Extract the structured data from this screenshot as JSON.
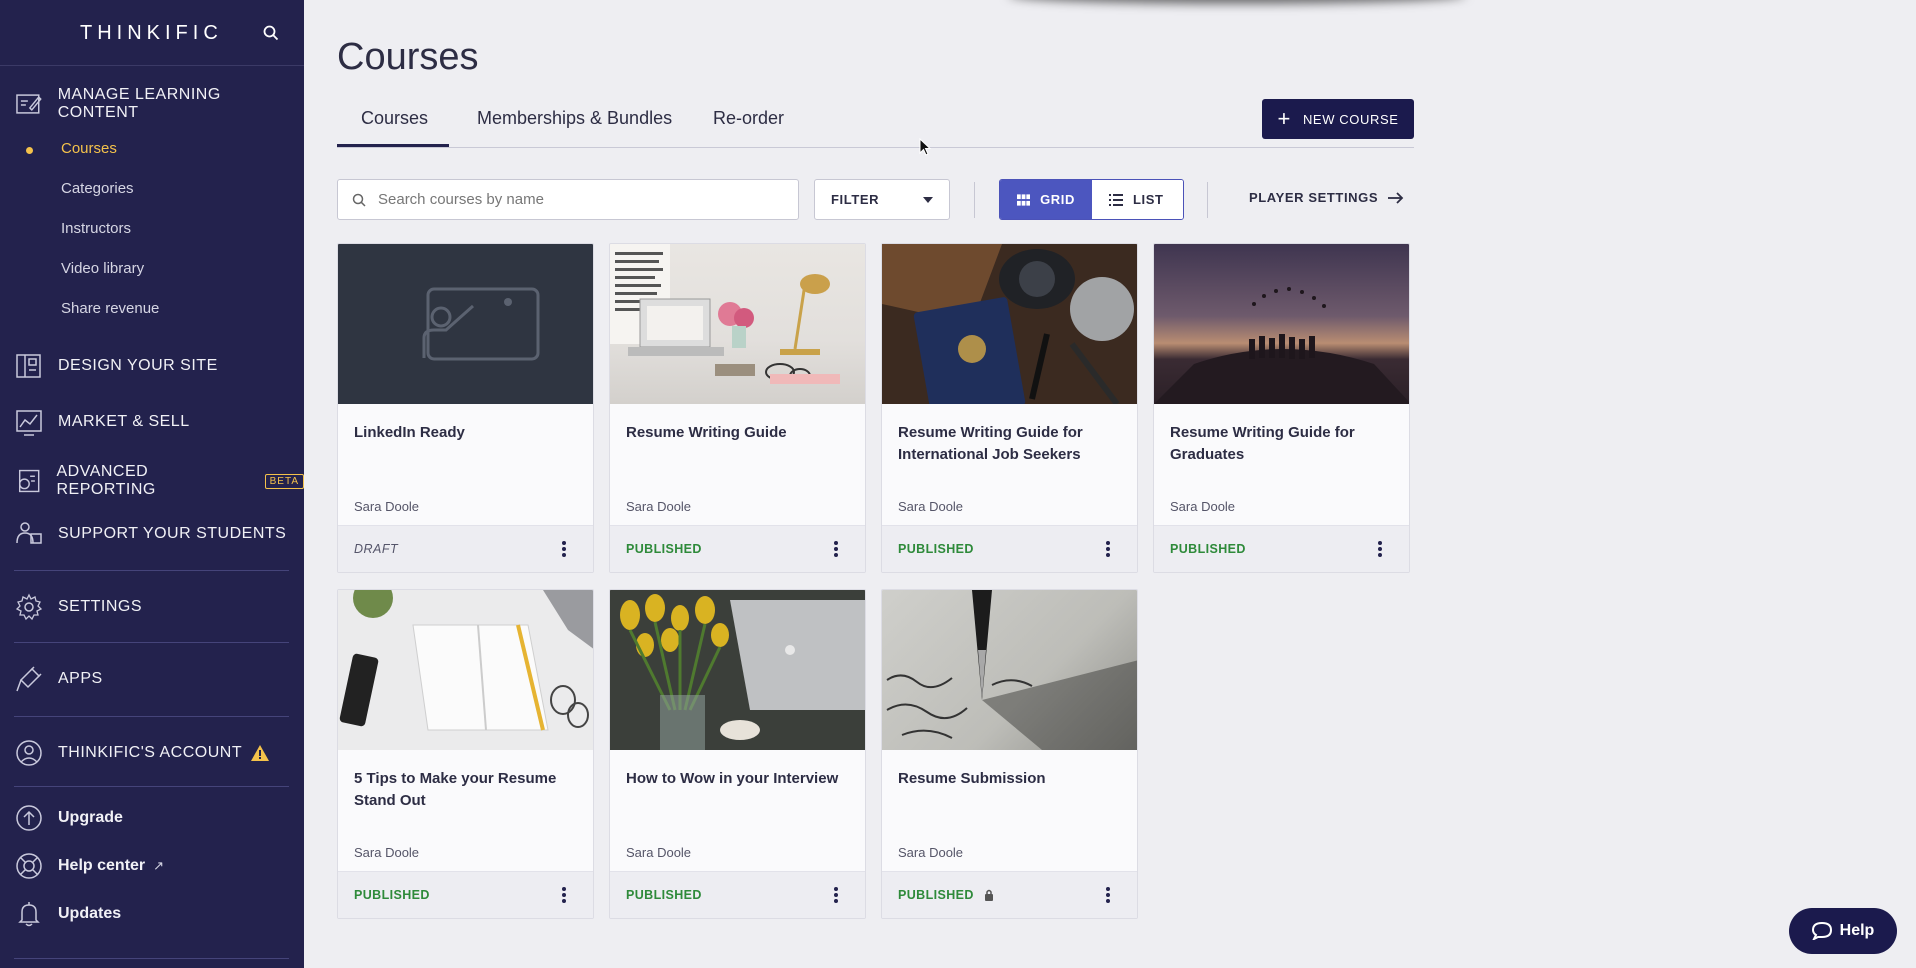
{
  "sidebar": {
    "brand": "THINKIFIC",
    "sections": {
      "manage": "MANAGE LEARNING CONTENT",
      "design": "DESIGN YOUR SITE",
      "market": "MARKET & SELL",
      "reporting": "ADVANCED REPORTING",
      "reporting_badge": "BETA",
      "support": "SUPPORT YOUR STUDENTS",
      "settings": "SETTINGS",
      "apps": "APPS",
      "account": "THINKIFIC'S ACCOUNT"
    },
    "sub_items": [
      "Courses",
      "Categories",
      "Instructors",
      "Video library",
      "Share revenue"
    ],
    "bottom": {
      "upgrade": "Upgrade",
      "help_center": "Help center",
      "updates": "Updates"
    }
  },
  "page": {
    "title": "Courses",
    "tabs": [
      "Courses",
      "Memberships & Bundles",
      "Re-order"
    ],
    "new_course": "NEW COURSE",
    "search_placeholder": "Search courses by name",
    "filter": "FILTER",
    "view_grid": "GRID",
    "view_list": "LIST",
    "player_settings": "PLAYER SETTINGS"
  },
  "courses": [
    {
      "title": "LinkedIn Ready",
      "author": "Sara Doole",
      "status": "DRAFT"
    },
    {
      "title": "Resume Writing Guide",
      "author": "Sara Doole",
      "status": "PUBLISHED"
    },
    {
      "title": "Resume Writing Guide for International Job Seekers",
      "author": "Sara Doole",
      "status": "PUBLISHED"
    },
    {
      "title": "Resume Writing Guide for Graduates",
      "author": "Sara Doole",
      "status": "PUBLISHED"
    },
    {
      "title": "5 Tips to Make your Resume Stand Out",
      "author": "Sara Doole",
      "status": "PUBLISHED"
    },
    {
      "title": "How to Wow in your Interview",
      "author": "Sara Doole",
      "status": "PUBLISHED"
    },
    {
      "title": "Resume Submission",
      "author": "Sara Doole",
      "status": "PUBLISHED"
    }
  ],
  "help_button": "Help",
  "colors": {
    "sidebar": "#23224d",
    "accent": "#f4c24b",
    "primary": "#1b1a4d",
    "published": "#2e8a3a",
    "toggle": "#4c56bf"
  }
}
